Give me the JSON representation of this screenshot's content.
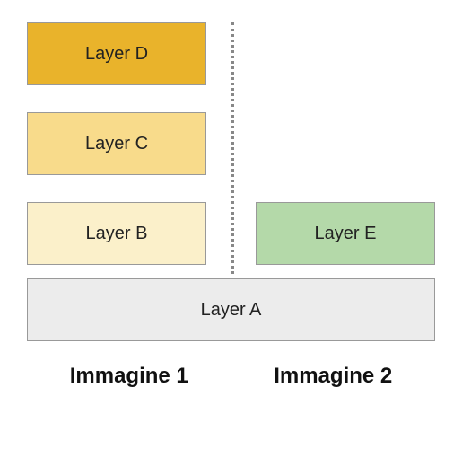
{
  "layers": {
    "d": {
      "label": "Layer D",
      "color": "#e9b32b"
    },
    "c": {
      "label": "Layer C",
      "color": "#f8db8b"
    },
    "b": {
      "label": "Layer B",
      "color": "#fbf0ca"
    },
    "e": {
      "label": "Layer E",
      "color": "#b4d9a9"
    },
    "a": {
      "label": "Layer A",
      "color": "#ececec"
    }
  },
  "captions": {
    "left": "Immagine 1",
    "right": "Immagine 2"
  }
}
